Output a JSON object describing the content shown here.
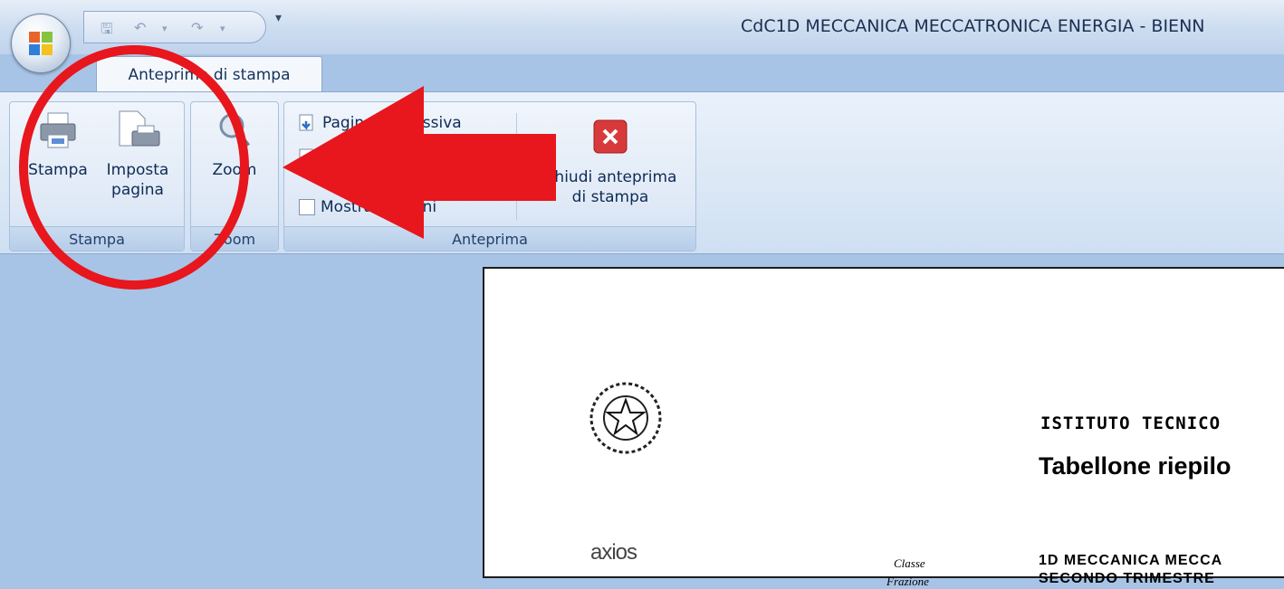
{
  "window": {
    "title": "CdC1D MECCANICA  MECCATRONICA ENERGIA - BIENN"
  },
  "tabs": [
    {
      "label": "Anteprima di stampa"
    }
  ],
  "ribbon": {
    "groups": {
      "stampa": {
        "label": "Stampa",
        "buttons": [
          {
            "label": "Stampa",
            "icon": "printer-icon"
          },
          {
            "label_line1": "Imposta",
            "label_line2": "pagina",
            "icon": "page-setup-icon"
          }
        ]
      },
      "zoom": {
        "label": "Zoom",
        "buttons": [
          {
            "label": "Zoom",
            "icon": "magnifier-icon"
          }
        ]
      },
      "anteprima": {
        "label": "Anteprima",
        "next_page": "Pagina successiva",
        "previous_page": "Pagina precedente",
        "show_margins": "Mostra margini",
        "close_line1": "Chiudi anteprima",
        "close_line2": "di stampa"
      }
    }
  },
  "document": {
    "header1": "ISTITUTO TECNICO",
    "header2": "Tabellone riepilo",
    "label_classe": "Classe",
    "label_frazione": "Frazione",
    "value_classe": "1D MECCANICA  MECCA",
    "value_frazione": "SECONDO TRIMESTRE",
    "logo_text": "axios"
  },
  "colors": {
    "annotation": "#e8161d",
    "ribbon_bg": "#dbe7f5",
    "workspace": "#a7c4e6"
  }
}
